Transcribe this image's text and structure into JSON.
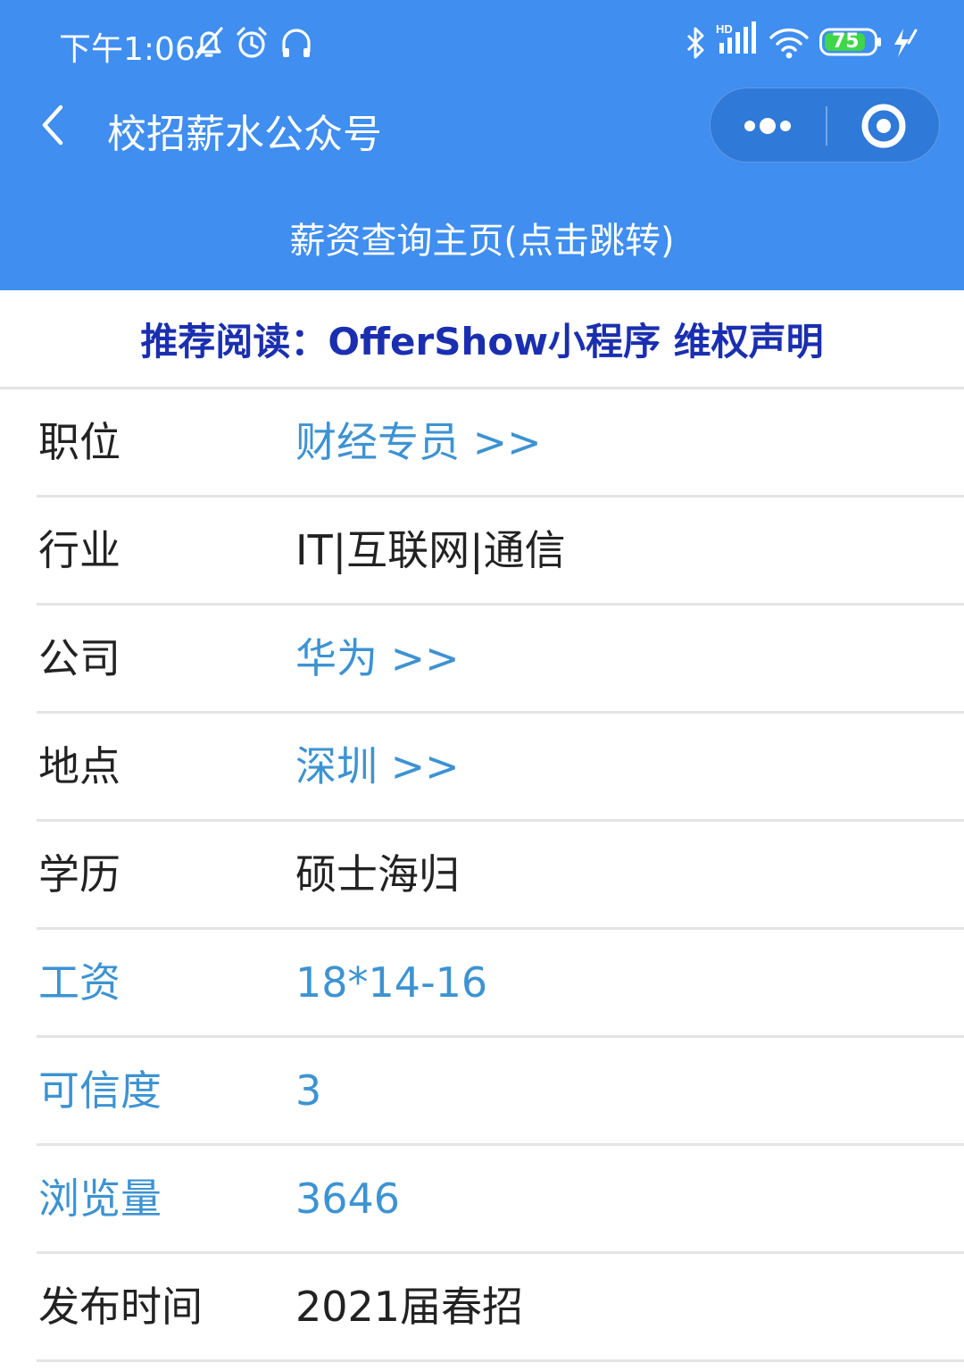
{
  "status_bar": {
    "time": "下午1:06",
    "battery_level": "75",
    "icons": [
      "mute-icon",
      "alarm-icon",
      "headset-icon",
      "bluetooth-icon",
      "hd-signal-icon",
      "wifi-icon",
      "battery-icon",
      "charging-icon"
    ]
  },
  "nav": {
    "title": "校招薪水公众号",
    "back_icon": "back-arrow-icon",
    "more_icon": "more-dots-icon",
    "close_icon": "target-close-icon"
  },
  "banner": {
    "label": "薪资查询主页(点击跳转)"
  },
  "recommend": {
    "label": "推荐阅读：OfferShow小程序 维权声明"
  },
  "details": [
    {
      "key": "position",
      "label": "职位",
      "value": "财经专员 >>",
      "link": true
    },
    {
      "key": "industry",
      "label": "行业",
      "value": "IT|互联网|通信"
    },
    {
      "key": "company",
      "label": "公司",
      "value": "华为 >>",
      "link": true
    },
    {
      "key": "location",
      "label": "地点",
      "value": "深圳 >>",
      "link": true
    },
    {
      "key": "education",
      "label": "学历",
      "value": "硕士海归"
    },
    {
      "key": "salary",
      "label": "工资",
      "value": "18*14-16",
      "highlight": true
    },
    {
      "key": "credibility",
      "label": "可信度",
      "value": "3",
      "highlight": true
    },
    {
      "key": "views",
      "label": "浏览量",
      "value": "3646",
      "highlight": true
    },
    {
      "key": "publish-time",
      "label": "发布时间",
      "value": "2021届春招"
    }
  ],
  "colors": {
    "header_blue": "#3f8ef0",
    "link_blue": "#3d93d2",
    "recommend_navy": "#1a2fb0",
    "divider": "#e4e4e4"
  }
}
